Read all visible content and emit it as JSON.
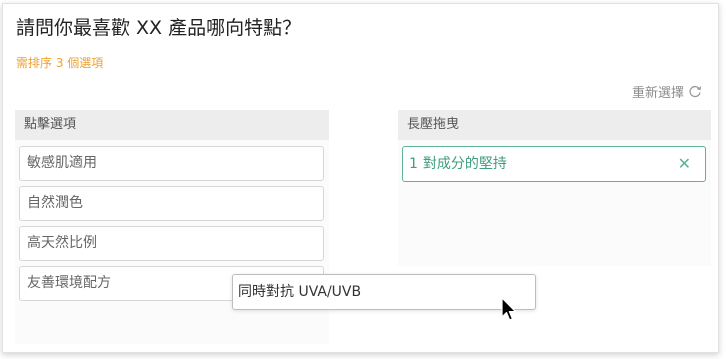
{
  "question": "請問你最喜歡 XX 產品哪向特點？",
  "hint": "需排序 3 個選項",
  "reset_label": "重新選擇",
  "left_panel": {
    "title": "點擊選項",
    "options": [
      {
        "label": "敏感肌適用"
      },
      {
        "label": "自然潤色"
      },
      {
        "label": "高天然比例"
      },
      {
        "label": "友善環境配方"
      }
    ]
  },
  "right_panel": {
    "title": "長壓拖曳",
    "selected": [
      {
        "number": "1",
        "label": "對成分的堅持",
        "remove_icon": "✕"
      }
    ]
  },
  "dragging_item": {
    "label": "同時對抗 UVA/UVB"
  },
  "icons": {
    "reset": "refresh-icon",
    "cursor": "mouse-pointer-icon"
  },
  "colors": {
    "hint": "#f0a030",
    "selected_accent": "#5fb394"
  }
}
